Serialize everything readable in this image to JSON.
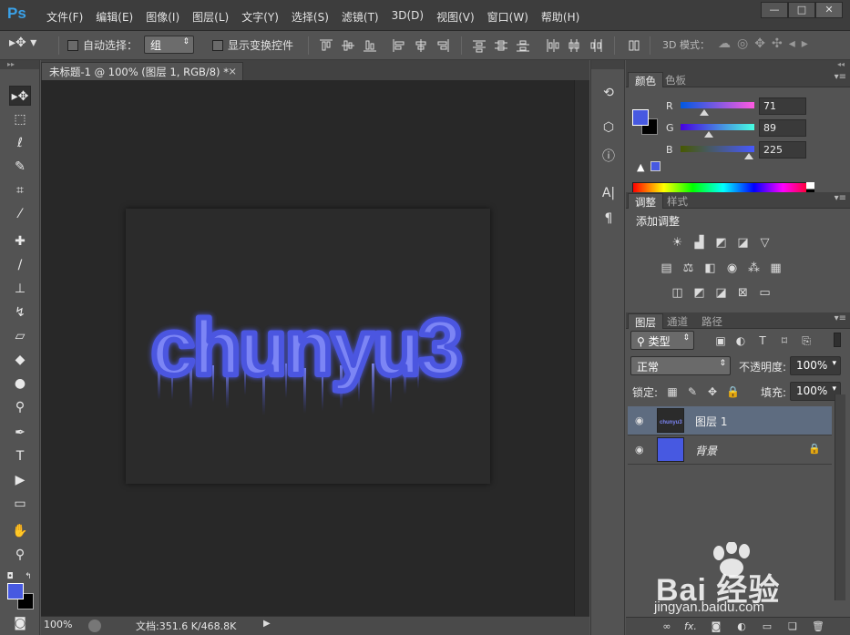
{
  "app": {
    "logo": "Ps"
  },
  "menu": [
    "文件(F)",
    "编辑(E)",
    "图像(I)",
    "图层(L)",
    "文字(Y)",
    "选择(S)",
    "滤镜(T)",
    "3D(D)",
    "视图(V)",
    "窗口(W)",
    "帮助(H)"
  ],
  "window_controls": {
    "minimize": "—",
    "maximize": "□",
    "close": "✕"
  },
  "options": {
    "auto_select_label": "自动选择：",
    "auto_select_value": "组",
    "show_transform_label": "显示变换控件",
    "mode_3d_label": "3D 模式："
  },
  "document": {
    "tab_title": "未标题-1 @ 100% (图层 1, RGB/8) *",
    "tab_close": "×",
    "artwork_text": "chunyu3",
    "zoom": "100%",
    "doc_info": "文档:351.6 K/468.8K"
  },
  "color_panel": {
    "tabs": [
      "颜色",
      "色板"
    ],
    "r_label": "R",
    "r_value": "71",
    "g_label": "G",
    "g_value": "89",
    "b_label": "B",
    "b_value": "225",
    "foreground": "#4759e1",
    "background": "#000000"
  },
  "adjustments_panel": {
    "tabs": [
      "调整",
      "样式"
    ],
    "title": "添加调整"
  },
  "layers_panel": {
    "tabs": [
      "图层",
      "通道",
      "路径"
    ],
    "filter_label": "类型",
    "blend_mode": "正常",
    "opacity_label": "不透明度:",
    "opacity_value": "100%",
    "lock_label": "锁定:",
    "fill_label": "填充:",
    "fill_value": "100%",
    "layers": [
      {
        "name": "图层 1",
        "thumb_text": "chunyu3",
        "selected": true
      },
      {
        "name": "背景",
        "locked": true,
        "thumb_color": "#4759e1"
      }
    ],
    "bottom_fx": "fx."
  },
  "watermark": {
    "brand": "Bai 经验",
    "url": "jingyan.baidu.com"
  }
}
